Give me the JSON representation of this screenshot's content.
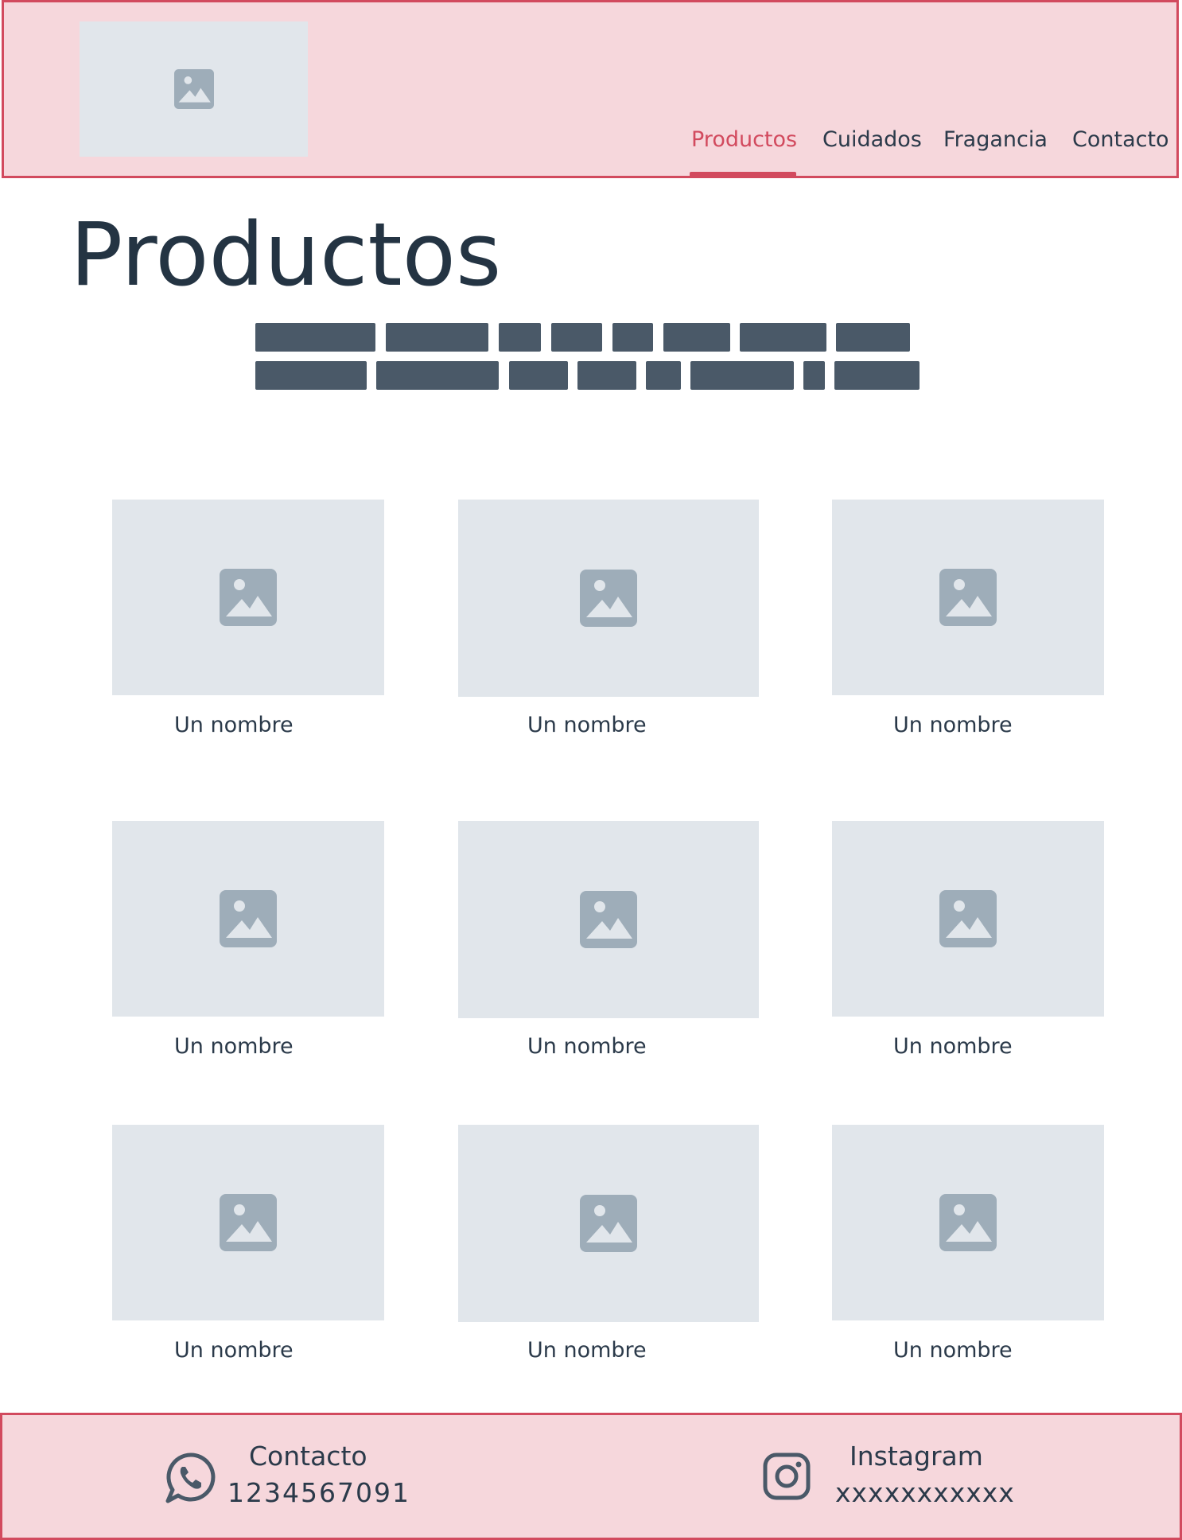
{
  "header": {
    "logo_icon": "image-placeholder-icon",
    "nav": [
      {
        "label": "Productos",
        "active": true
      },
      {
        "label": "Cuidados",
        "active": false
      },
      {
        "label": "Fragancia",
        "active": false
      },
      {
        "label": "Contacto",
        "active": false
      }
    ],
    "accent_color": "#d24a5e",
    "background_color": "#f6d7dc"
  },
  "main": {
    "title": "Productos",
    "products": [
      {
        "name": "Un nombre",
        "icon": "image-placeholder-icon"
      },
      {
        "name": "Un nombre",
        "icon": "image-placeholder-icon"
      },
      {
        "name": "Un nombre",
        "icon": "image-placeholder-icon"
      },
      {
        "name": "Un nombre",
        "icon": "image-placeholder-icon"
      },
      {
        "name": "Un nombre",
        "icon": "image-placeholder-icon"
      },
      {
        "name": "Un nombre",
        "icon": "image-placeholder-icon"
      },
      {
        "name": "Un nombre",
        "icon": "image-placeholder-icon"
      },
      {
        "name": "Un nombre",
        "icon": "image-placeholder-icon"
      },
      {
        "name": "Un nombre",
        "icon": "image-placeholder-icon"
      }
    ]
  },
  "footer": {
    "contact": {
      "title": "Contacto",
      "value": "1234567091",
      "icon": "whatsapp-icon"
    },
    "instagram": {
      "title": "Instagram",
      "value": "xxxxxxxxxxx",
      "icon": "instagram-icon"
    }
  }
}
